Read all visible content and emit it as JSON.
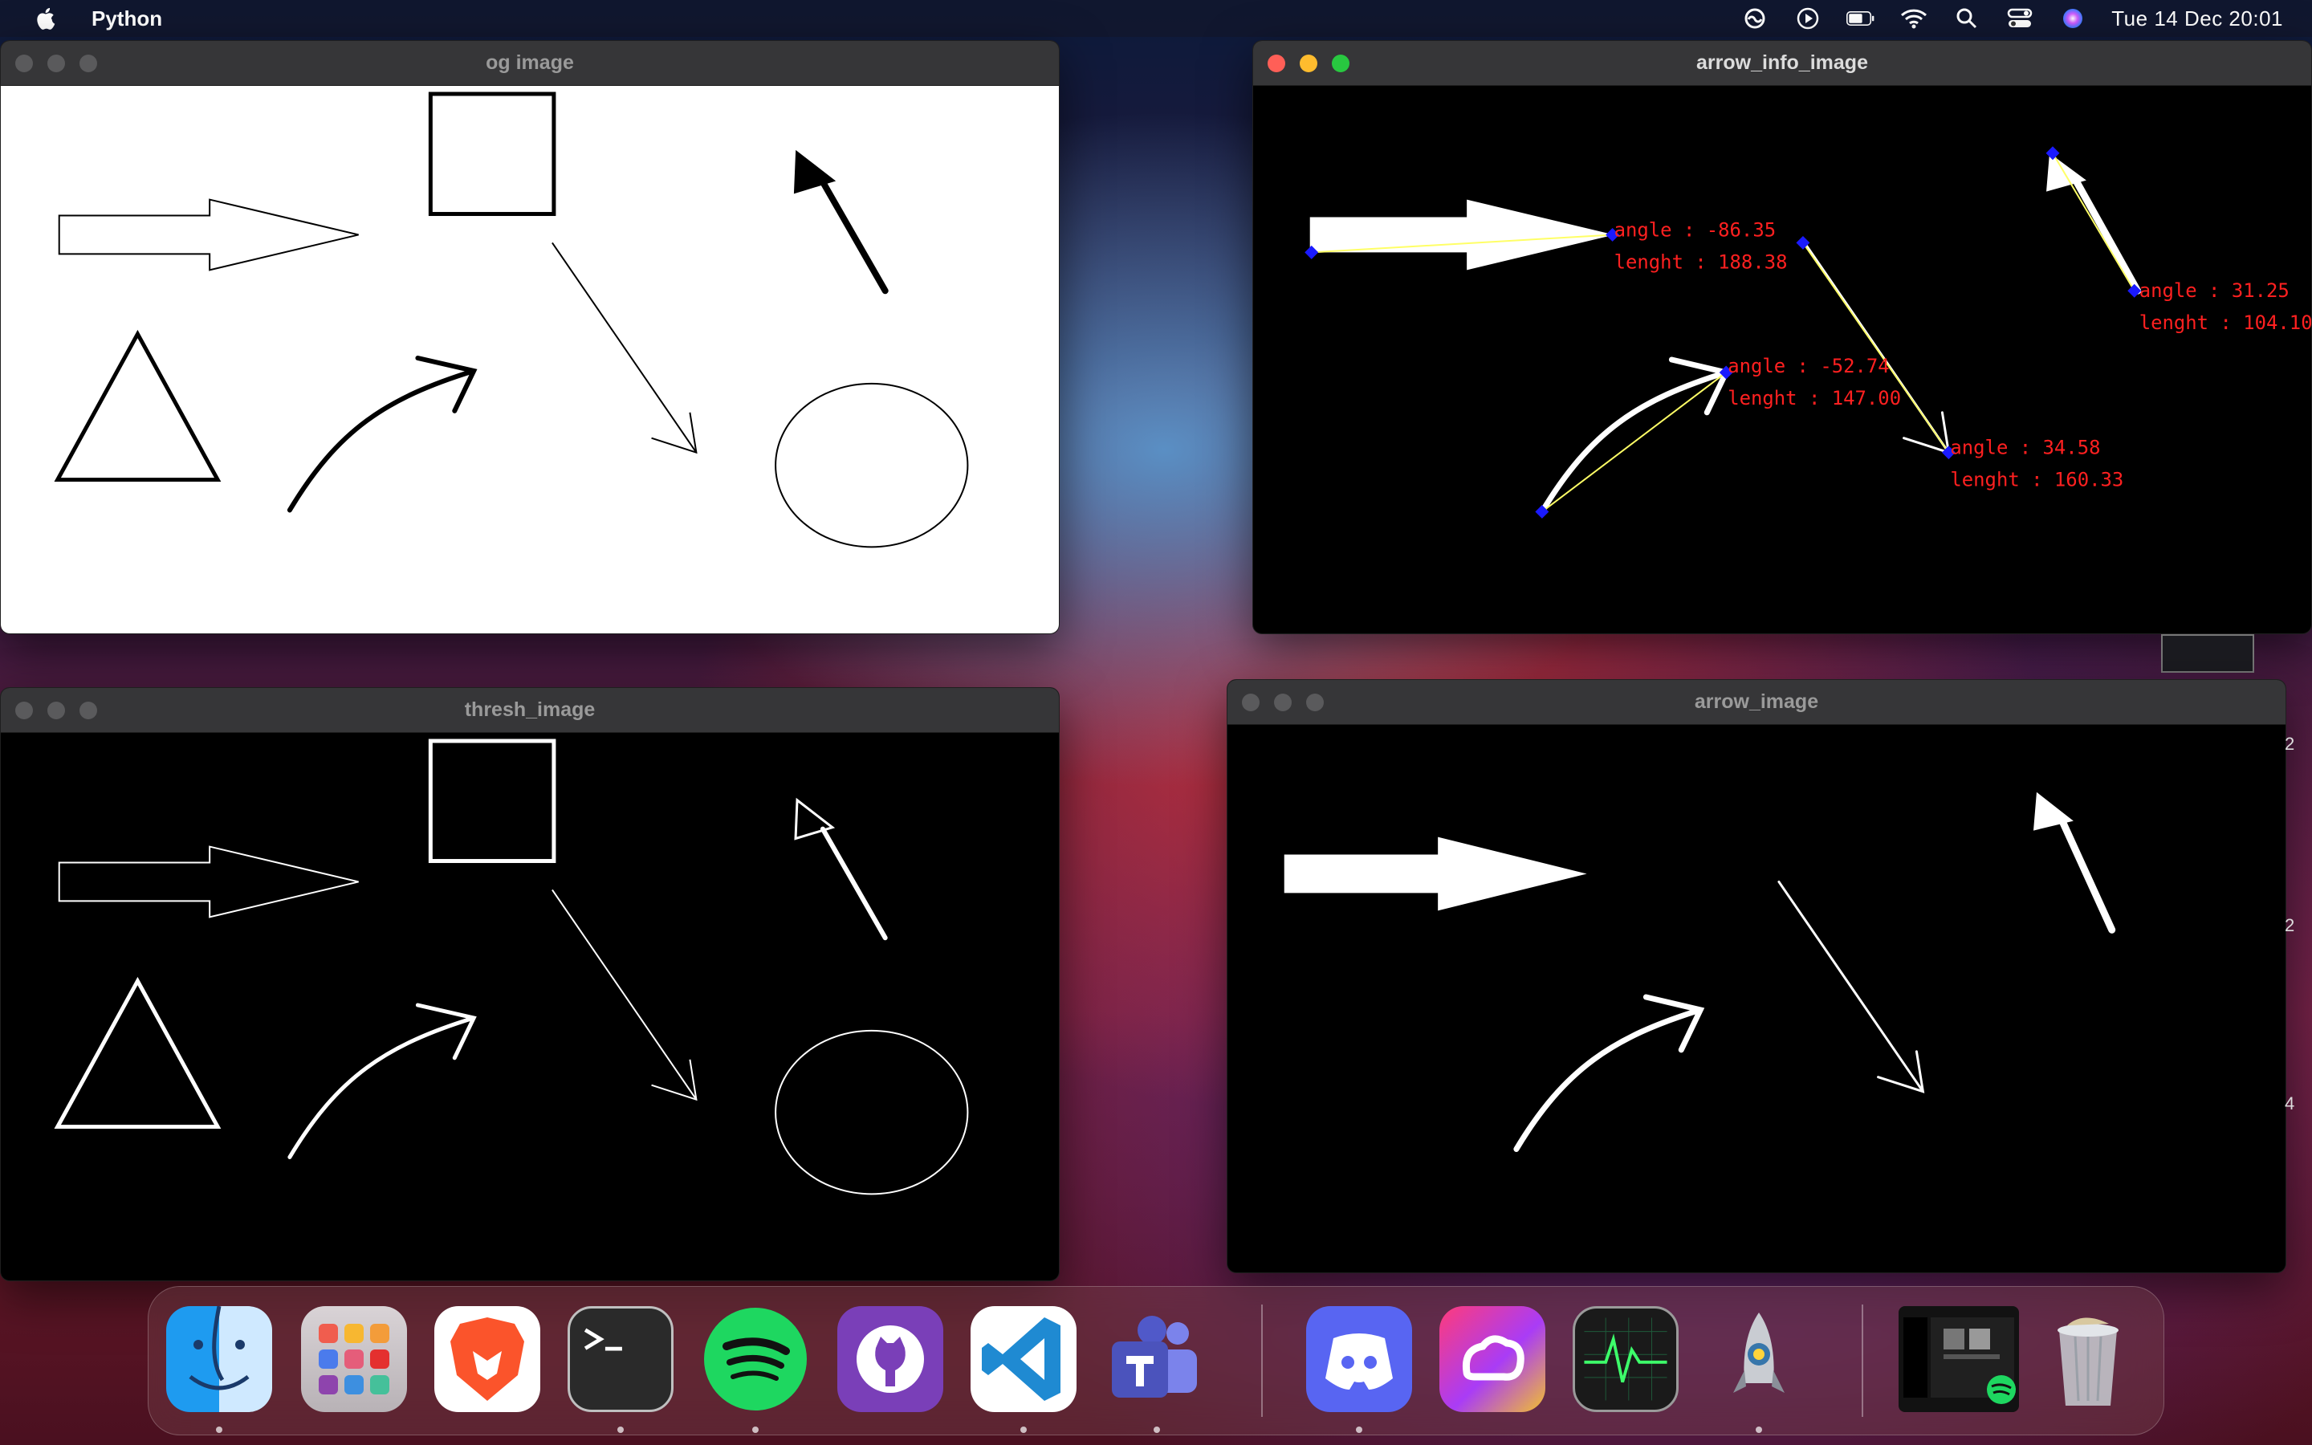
{
  "menubar": {
    "app_name": "Python",
    "clock": "Tue 14 Dec  20:01",
    "icons": [
      "apple-icon",
      "creative-cloud-icon",
      "play-icon",
      "battery-icon",
      "wifi-icon",
      "search-icon",
      "control-center-icon",
      "siri-icon"
    ]
  },
  "windows": {
    "og": {
      "title": "og image"
    },
    "info": {
      "title": "arrow_info_image",
      "labels": [
        {
          "angle": "angle : -86.35",
          "length": "lenght : 188.38"
        },
        {
          "angle": "angle : 31.25",
          "length": "lenght : 104.10"
        },
        {
          "angle": "angle : -52.74",
          "length": "lenght : 147.00"
        },
        {
          "angle": "angle : 34.58",
          "length": "lenght : 160.33"
        }
      ]
    },
    "thresh": {
      "title": "thresh_image"
    },
    "arrow": {
      "title": "arrow_image"
    }
  },
  "dock": {
    "apps": [
      "Finder",
      "Launchpad",
      "Brave",
      "Terminal",
      "Spotify",
      "GitHub Desktop",
      "Visual Studio Code",
      "Microsoft Teams",
      "Discord",
      "Creative Cloud",
      "Activity Monitor",
      "Python",
      "Spotify Window",
      "Trash"
    ]
  },
  "side_digits": [
    "2",
    "2",
    "4"
  ],
  "colors": {
    "label_red": "#ff2020",
    "keypoint_blue": "#1a1aff",
    "line_yellow": "#ffff66"
  }
}
